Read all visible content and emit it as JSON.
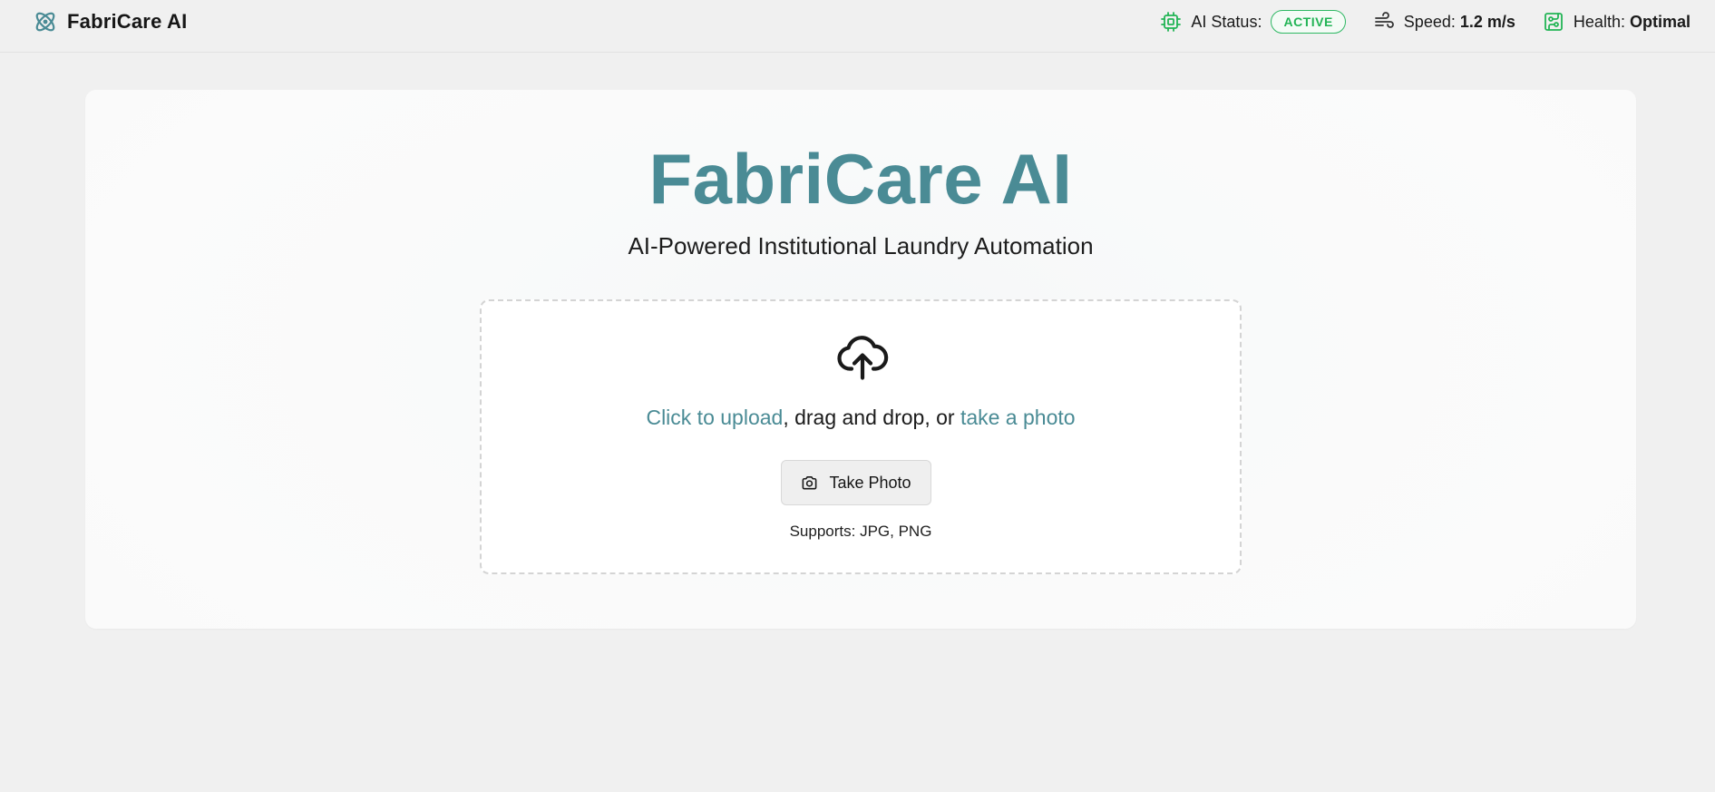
{
  "header": {
    "app_name": "FabriCare AI",
    "logo_icon": "atom-icon",
    "status_items": {
      "ai_status": {
        "label": "AI Status:",
        "value": "ACTIVE",
        "icon": "cpu-chip-icon",
        "badge_color": "#22b455"
      },
      "speed": {
        "label": "Speed:",
        "value": "1.2 m/s",
        "icon": "wind-icon"
      },
      "health": {
        "label": "Health:",
        "value": "Optimal",
        "icon": "circuit-board-icon",
        "icon_color": "#22b455"
      }
    }
  },
  "hero": {
    "title": "FabriCare AI",
    "subtitle": "AI-Powered Institutional Laundry Automation"
  },
  "upload": {
    "icon": "cloud-upload-icon",
    "click_link": "Click to upload",
    "middle_text": ", drag and drop, or ",
    "photo_link": "take a photo",
    "button_label": "Take Photo",
    "button_icon": "camera-icon",
    "supports": "Supports: JPG, PNG"
  },
  "colors": {
    "accent": "#4a8b95",
    "status_green": "#22b455",
    "page_background": "#f0f0f0",
    "card_background": "#fafafa"
  }
}
